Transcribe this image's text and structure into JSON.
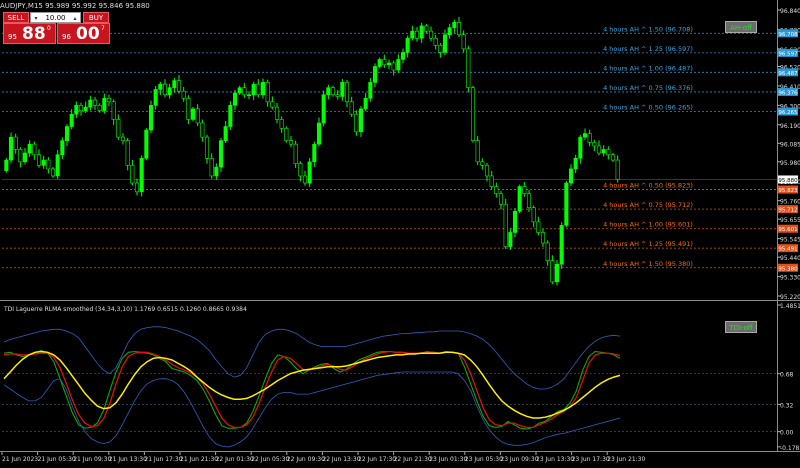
{
  "header": {
    "title": "AUDJPY,M15  95.989 95.992 95.846 95.880",
    "sell_label": "SELL",
    "buy_label": "BUY",
    "lot": "10.00",
    "sell_price": {
      "small": "95",
      "big": "88",
      "sup": "0"
    },
    "buy_price": {
      "small": "96",
      "big": "00",
      "sup": "7"
    }
  },
  "buttons": {
    "ah": "AH-off",
    "tdi": "TDI-off"
  },
  "indicator_title": "TDI Laguerre RLMA smoothed (34,34,3,10) 1.1769 0.6515 0.1260 0.8665 0.9384",
  "colors": {
    "background": "#000000",
    "grid": "#3a4a5c",
    "candle": "#00ff00",
    "level_up": "#3ba7e0",
    "level_down": "#ff6a00",
    "current_line": "#c81414",
    "current_badge": "#c81414",
    "rsi": "#00b000",
    "signal": "#e01010",
    "slow": "#ffee00",
    "bands": "#3060c0"
  },
  "chart_data": [
    {
      "type": "candlestick",
      "title": "AUDJPY,M15",
      "ylim": [
        95.22,
        96.84
      ],
      "y_ticks": [
        "96.840",
        "96.730",
        "96.620",
        "96.520",
        "96.410",
        "96.300",
        "96.190",
        "96.085",
        "95.980",
        "95.870",
        "95.760",
        "95.655",
        "95.545",
        "95.440",
        "95.330",
        "95.220"
      ],
      "current_price": 95.88,
      "current_price_label": "95.880",
      "ohlc_path": [
        95.93,
        95.99,
        96.12,
        96.05,
        95.98,
        96.03,
        96.08,
        96.02,
        95.96,
        95.99,
        95.94,
        95.9,
        96.02,
        96.1,
        96.18,
        96.25,
        96.3,
        96.27,
        96.29,
        96.33,
        96.3,
        96.27,
        96.34,
        96.32,
        96.22,
        96.12,
        96.1,
        95.96,
        95.86,
        95.81,
        96.0,
        96.16,
        96.3,
        96.39,
        96.42,
        96.36,
        96.4,
        96.44,
        96.38,
        96.34,
        96.22,
        96.28,
        96.2,
        96.12,
        96.0,
        95.9,
        95.95,
        96.1,
        96.18,
        96.3,
        96.37,
        96.4,
        96.36,
        96.36,
        96.42,
        96.36,
        96.43,
        96.32,
        96.29,
        96.22,
        96.17,
        96.1,
        96.08,
        95.97,
        95.9,
        95.86,
        95.98,
        96.08,
        96.2,
        96.36,
        96.4,
        96.36,
        96.35,
        96.43,
        96.32,
        96.25,
        96.15,
        96.28,
        96.34,
        96.43,
        96.52,
        96.56,
        96.53,
        96.54,
        96.5,
        96.56,
        96.6,
        96.68,
        96.72,
        96.68,
        96.75,
        96.72,
        96.68,
        96.64,
        96.6,
        96.7,
        96.74,
        96.77,
        96.7,
        96.62,
        96.4,
        96.1,
        95.98,
        95.96,
        95.9,
        95.84,
        95.8,
        95.74,
        95.5,
        95.58,
        95.7,
        95.84,
        95.8,
        95.72,
        95.64,
        95.58,
        95.52,
        95.42,
        95.3,
        95.4,
        95.62,
        95.86,
        95.94,
        96.0,
        96.12,
        96.14,
        96.09,
        96.07,
        96.03,
        96.05,
        96.02,
        95.99,
        95.88
      ],
      "levels": [
        {
          "label": "4 hours AH ^ 1.50 (96.708)",
          "value": 96.708,
          "badge": "96.708",
          "dir": "up"
        },
        {
          "label": "4 hours AH ^ 1.25 (96.597)",
          "value": 96.597,
          "badge": "96.597",
          "dir": "up"
        },
        {
          "label": "4 hours AH ^ 1.00 (96.487)",
          "value": 96.487,
          "badge": "96.487",
          "dir": "up"
        },
        {
          "label": "4 hours AH ^ 0.75 (96.376)",
          "value": 96.376,
          "badge": "96.376",
          "dir": "up"
        },
        {
          "label": "4 hours AH ^ 0.50 (96.265)",
          "value": 96.265,
          "badge": "96.265",
          "dir": "up"
        },
        {
          "label": "4 hours AH ^ 0.50 (95.823)",
          "value": 95.823,
          "badge": "95.823",
          "dir": "down"
        },
        {
          "label": "4 hours AH ^ 0.75 (95.712)",
          "value": 95.712,
          "badge": "95.712",
          "dir": "down"
        },
        {
          "label": "4 hours AH ^ 1.00 (95.601)",
          "value": 95.601,
          "badge": "95.601",
          "dir": "down"
        },
        {
          "label": "4 hours AH ^ 1.25 (95.491)",
          "value": 95.491,
          "badge": "95.491",
          "dir": "down"
        },
        {
          "label": "4 hours AH ^ 1.50 (95.380)",
          "value": 95.38,
          "badge": "95.380",
          "dir": "down"
        }
      ]
    },
    {
      "type": "line",
      "title": "TDI Laguerre RLMA smoothed (34,34,3,10) 1.1769 0.6515 0.1260 0.8665 0.9384",
      "ylim": [
        -0.18,
        1.4851
      ],
      "y_ticks": [
        {
          "label": "1.4851",
          "value": 1.4851
        },
        {
          "label": "0.68",
          "value": 0.68
        },
        {
          "label": "0.32",
          "value": 0.32
        },
        {
          "label": "0.00",
          "value": 0.0
        },
        {
          "label": "-0.1783",
          "value": -0.1783
        }
      ],
      "series": [
        {
          "name": "rsi",
          "values": [
            0.92,
            0.93,
            0.9,
            0.88,
            0.9,
            0.93,
            0.95,
            0.92,
            0.82,
            0.62,
            0.42,
            0.22,
            0.08,
            0.04,
            0.05,
            0.1,
            0.25,
            0.48,
            0.7,
            0.86,
            0.93,
            0.94,
            0.93,
            0.92,
            0.9,
            0.86,
            0.82,
            0.74,
            0.72,
            0.7,
            0.66,
            0.6,
            0.5,
            0.36,
            0.2,
            0.07,
            0.04,
            0.04,
            0.05,
            0.1,
            0.24,
            0.42,
            0.62,
            0.8,
            0.9,
            0.88,
            0.82,
            0.74,
            0.68,
            0.72,
            0.76,
            0.79,
            0.8,
            0.74,
            0.7,
            0.73,
            0.79,
            0.84,
            0.87,
            0.9,
            0.93,
            0.94,
            0.94,
            0.93,
            0.93,
            0.92,
            0.92,
            0.92,
            0.94,
            0.93,
            0.92,
            0.94,
            0.93,
            0.92,
            0.76,
            0.56,
            0.36,
            0.18,
            0.07,
            0.05,
            0.06,
            0.12,
            0.08,
            0.04,
            0.03,
            0.05,
            0.1,
            0.12,
            0.18,
            0.24,
            0.26,
            0.34,
            0.48,
            0.72,
            0.88,
            0.94,
            0.93,
            0.92,
            0.9,
            0.86
          ]
        },
        {
          "name": "signal",
          "values": [
            0.9,
            0.91,
            0.91,
            0.9,
            0.9,
            0.91,
            0.92,
            0.92,
            0.87,
            0.75,
            0.57,
            0.37,
            0.2,
            0.1,
            0.06,
            0.07,
            0.15,
            0.33,
            0.56,
            0.76,
            0.88,
            0.92,
            0.93,
            0.93,
            0.91,
            0.88,
            0.84,
            0.79,
            0.75,
            0.72,
            0.69,
            0.64,
            0.56,
            0.44,
            0.3,
            0.16,
            0.08,
            0.05,
            0.05,
            0.08,
            0.17,
            0.33,
            0.52,
            0.7,
            0.84,
            0.88,
            0.86,
            0.8,
            0.73,
            0.72,
            0.74,
            0.77,
            0.79,
            0.77,
            0.73,
            0.72,
            0.76,
            0.81,
            0.85,
            0.88,
            0.91,
            0.93,
            0.94,
            0.93,
            0.93,
            0.92,
            0.92,
            0.92,
            0.93,
            0.93,
            0.92,
            0.93,
            0.93,
            0.92,
            0.84,
            0.68,
            0.48,
            0.28,
            0.14,
            0.08,
            0.07,
            0.1,
            0.1,
            0.07,
            0.05,
            0.05,
            0.08,
            0.11,
            0.15,
            0.2,
            0.24,
            0.3,
            0.4,
            0.6,
            0.8,
            0.9,
            0.92,
            0.92,
            0.91,
            0.89
          ]
        },
        {
          "name": "slow",
          "values": [
            0.62,
            0.7,
            0.78,
            0.85,
            0.9,
            0.93,
            0.94,
            0.93,
            0.9,
            0.84,
            0.75,
            0.65,
            0.55,
            0.45,
            0.37,
            0.3,
            0.27,
            0.28,
            0.34,
            0.44,
            0.56,
            0.67,
            0.76,
            0.82,
            0.86,
            0.87,
            0.86,
            0.84,
            0.8,
            0.76,
            0.71,
            0.64,
            0.58,
            0.52,
            0.47,
            0.43,
            0.4,
            0.38,
            0.38,
            0.39,
            0.42,
            0.46,
            0.5,
            0.55,
            0.6,
            0.64,
            0.68,
            0.7,
            0.72,
            0.73,
            0.74,
            0.75,
            0.76,
            0.76,
            0.76,
            0.77,
            0.79,
            0.81,
            0.83,
            0.85,
            0.87,
            0.88,
            0.89,
            0.9,
            0.9,
            0.91,
            0.91,
            0.92,
            0.92,
            0.92,
            0.92,
            0.93,
            0.93,
            0.92,
            0.9,
            0.84,
            0.76,
            0.66,
            0.55,
            0.45,
            0.36,
            0.3,
            0.25,
            0.21,
            0.18,
            0.16,
            0.16,
            0.17,
            0.19,
            0.22,
            0.25,
            0.29,
            0.34,
            0.4,
            0.46,
            0.52,
            0.57,
            0.61,
            0.64,
            0.66
          ]
        },
        {
          "name": "upper_band",
          "values": [
            1.05,
            1.08,
            1.1,
            1.12,
            1.14,
            1.16,
            1.18,
            1.19,
            1.2,
            1.2,
            1.18,
            1.15,
            1.1,
            1.0,
            0.9,
            0.8,
            0.72,
            0.68,
            0.75,
            0.9,
            1.05,
            1.15,
            1.2,
            1.22,
            1.23,
            1.23,
            1.22,
            1.2,
            1.18,
            1.15,
            1.12,
            1.08,
            1.02,
            0.95,
            0.85,
            0.76,
            0.68,
            0.64,
            0.66,
            0.75,
            0.9,
            1.05,
            1.14,
            1.18,
            1.2,
            1.2,
            1.18,
            1.15,
            1.1,
            1.05,
            1.02,
            1.0,
            1.0,
            1.0,
            1.0,
            1.0,
            1.02,
            1.04,
            1.06,
            1.08,
            1.1,
            1.12,
            1.13,
            1.14,
            1.15,
            1.15,
            1.16,
            1.16,
            1.17,
            1.17,
            1.18,
            1.18,
            1.18,
            1.18,
            1.17,
            1.15,
            1.12,
            1.08,
            1.02,
            0.94,
            0.85,
            0.76,
            0.68,
            0.62,
            0.56,
            0.52,
            0.5,
            0.5,
            0.52,
            0.56,
            0.62,
            0.72,
            0.82,
            0.92,
            1.0,
            1.06,
            1.1,
            1.12,
            1.13,
            1.12
          ]
        },
        {
          "name": "lower_band",
          "values": [
            0.55,
            0.5,
            0.45,
            0.4,
            0.36,
            0.36,
            0.4,
            0.5,
            0.6,
            0.62,
            0.5,
            0.3,
            0.12,
            0.0,
            -0.08,
            -0.12,
            -0.14,
            -0.12,
            -0.05,
            0.08,
            0.22,
            0.36,
            0.48,
            0.56,
            0.6,
            0.62,
            0.62,
            0.6,
            0.55,
            0.46,
            0.34,
            0.2,
            0.06,
            -0.06,
            -0.14,
            -0.17,
            -0.18,
            -0.16,
            -0.12,
            -0.06,
            0.04,
            0.16,
            0.28,
            0.38,
            0.44,
            0.46,
            0.46,
            0.44,
            0.44,
            0.44,
            0.46,
            0.48,
            0.5,
            0.52,
            0.54,
            0.56,
            0.58,
            0.6,
            0.62,
            0.64,
            0.66,
            0.67,
            0.68,
            0.69,
            0.7,
            0.7,
            0.7,
            0.7,
            0.7,
            0.7,
            0.7,
            0.7,
            0.7,
            0.68,
            0.6,
            0.48,
            0.3,
            0.14,
            0.02,
            -0.06,
            -0.12,
            -0.15,
            -0.16,
            -0.16,
            -0.15,
            -0.13,
            -0.1,
            -0.07,
            -0.05,
            -0.03,
            -0.02,
            0.0,
            0.02,
            0.04,
            0.06,
            0.08,
            0.1,
            0.12,
            0.14,
            0.16
          ]
        }
      ]
    }
  ],
  "x_axis": [
    "21 Jun 2023",
    "21 Jun 05:30",
    "21 Jun 09:30",
    "21 Jun 13:30",
    "21 Jun 17:30",
    "21 Jun 21:30",
    "22 Jun 01:30",
    "22 Jun 05:30",
    "22 Jun 09:30",
    "22 Jun 13:30",
    "22 Jun 17:30",
    "22 Jun 21:30",
    "23 Jun 01:30",
    "23 Jun 05:30",
    "23 Jun 09:30",
    "23 Jun 13:30",
    "23 Jun 17:30",
    "23 Jun 21:30"
  ]
}
